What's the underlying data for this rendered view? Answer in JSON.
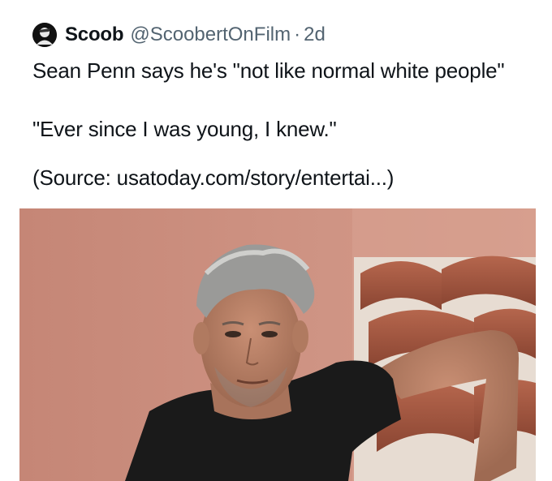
{
  "post": {
    "author_name": "Scoob",
    "author_handle": "@ScoobertOnFilm",
    "separator": "·",
    "time_ago": "2d",
    "text_lines": [
      "Sean Penn says he's \"not like normal white people\"",
      "\"Ever since I was young, I knew.\"",
      "(Source: usatoday.com/story/entertai...)"
    ]
  },
  "colors": {
    "text": "#0f1419",
    "secondary_text": "#536471",
    "photo_wall": "#c9897a",
    "photo_tiles": "#a85d45"
  },
  "icons": {
    "avatar": "user-avatar-icon"
  }
}
